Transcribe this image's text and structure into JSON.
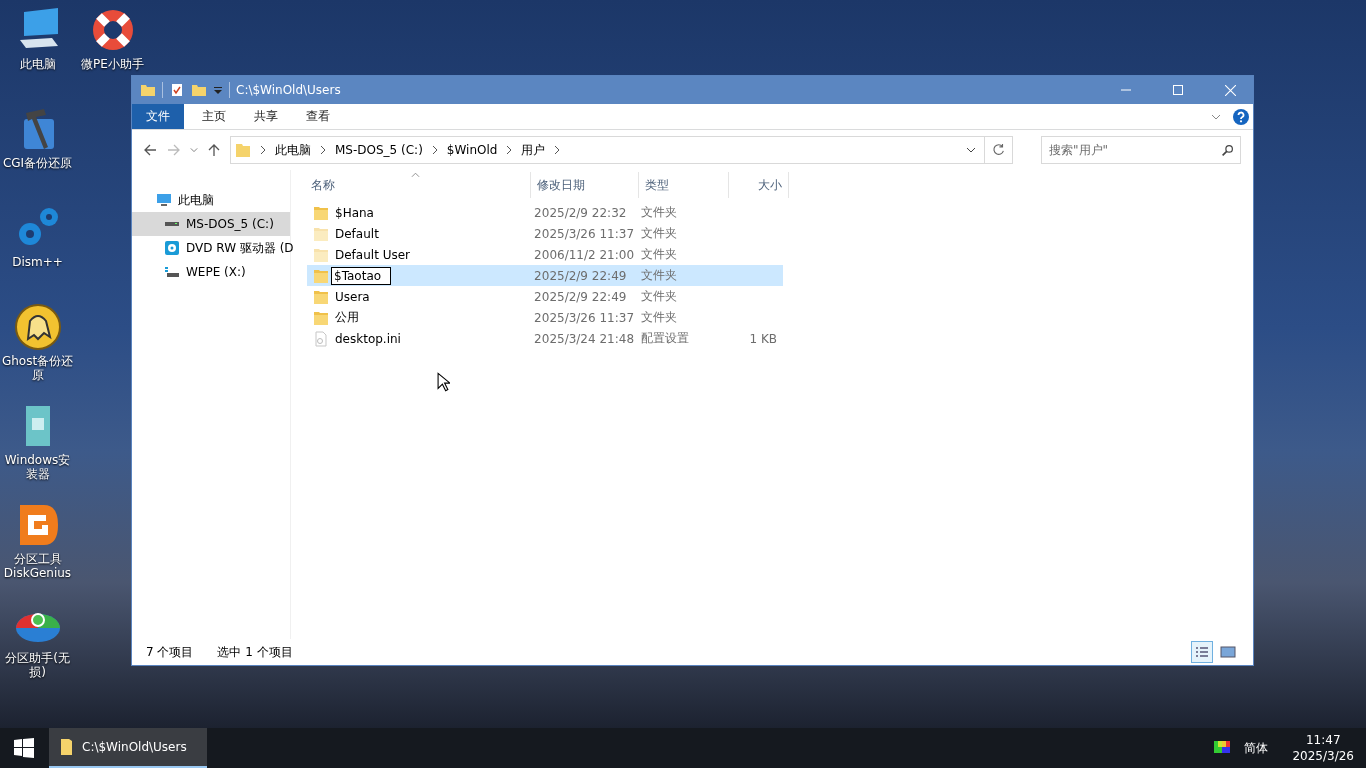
{
  "desktop_icons": [
    {
      "label": "此电脑",
      "kind": "computer"
    },
    {
      "label": "CGI备份还原",
      "kind": "hammer"
    },
    {
      "label": "Dism++",
      "kind": "gears"
    },
    {
      "label": "Ghost备份还原",
      "kind": "ghost"
    },
    {
      "label": "Windows安装器",
      "kind": "installer"
    },
    {
      "label": "分区工具 DiskGenius",
      "kind": "diskgenius"
    },
    {
      "label": "分区助手(无损)",
      "kind": "partition"
    },
    {
      "label": "微PE小助手",
      "kind": "lifebuoy"
    }
  ],
  "window": {
    "title": "C:\\$WinOld\\Users"
  },
  "ribbon_tabs": [
    {
      "label": "文件",
      "selected": true
    },
    {
      "label": "主页",
      "selected": false
    },
    {
      "label": "共享",
      "selected": false
    },
    {
      "label": "查看",
      "selected": false
    }
  ],
  "address": {
    "breadcrumbs": [
      "此电脑",
      "MS-DOS_5 (C:)",
      "$WinOld",
      "用户"
    ]
  },
  "search": {
    "placeholder": "搜索\"用户\""
  },
  "nav_tree": [
    {
      "label": "此电脑",
      "kind": "computer",
      "selected": false,
      "children": [
        {
          "label": "MS-DOS_5 (C:)",
          "kind": "drive",
          "selected": true
        },
        {
          "label": "DVD RW 驱动器 (D",
          "kind": "dvd",
          "selected": false
        },
        {
          "label": "WEPE (X:)",
          "kind": "usb",
          "selected": false
        }
      ]
    }
  ],
  "columns": [
    "名称",
    "修改日期",
    "类型",
    "大小"
  ],
  "files": [
    {
      "name": "$Hana",
      "date": "2025/2/9 22:32",
      "type": "文件夹",
      "kind": "folder",
      "hidden": false,
      "selected": false,
      "renaming": false
    },
    {
      "name": "Default",
      "date": "2025/3/26 11:37",
      "type": "文件夹",
      "kind": "folder",
      "hidden": true,
      "selected": false,
      "renaming": false
    },
    {
      "name": "Default User",
      "date": "2006/11/2 21:00",
      "type": "文件夹",
      "kind": "folder",
      "hidden": true,
      "selected": false,
      "renaming": false
    },
    {
      "name": "$Taotao",
      "date": "2025/2/9 22:49",
      "type": "文件夹",
      "kind": "folder",
      "hidden": false,
      "selected": true,
      "renaming": true
    },
    {
      "name": "Usera",
      "date": "2025/2/9 22:49",
      "type": "文件夹",
      "kind": "folder",
      "hidden": false,
      "selected": false,
      "renaming": false
    },
    {
      "name": "公用",
      "date": "2025/3/26 11:37",
      "type": "文件夹",
      "kind": "folder",
      "hidden": false,
      "selected": false,
      "renaming": false
    },
    {
      "name": "desktop.ini",
      "date": "2025/3/24 21:48",
      "type": "配置设置",
      "size": "1 KB",
      "kind": "file",
      "hidden": true,
      "selected": false,
      "renaming": false
    }
  ],
  "status_bar": {
    "item_count": "7 个项目",
    "selection": "选中 1 个项目"
  },
  "view_buttons": [
    {
      "kind": "details",
      "selected": true
    },
    {
      "kind": "large-icons",
      "selected": false
    }
  ],
  "taskbar": {
    "tasks": [
      {
        "label": "C:\\$WinOld\\Users",
        "selected": true
      }
    ],
    "language": "简体",
    "time": "11:47",
    "date": "2025/3/26"
  }
}
